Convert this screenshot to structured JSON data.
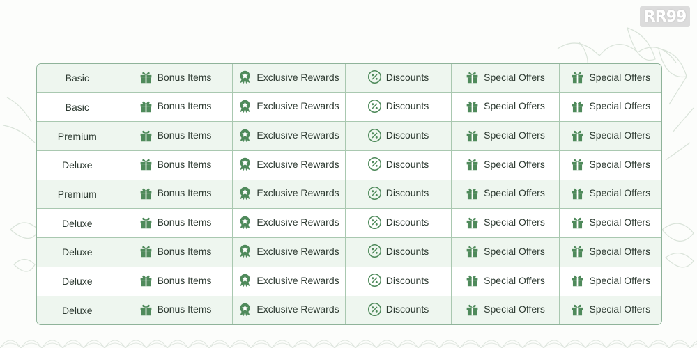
{
  "brand": {
    "logo_text": "RR99"
  },
  "colors": {
    "icon_green": "#4f8a5b",
    "row_tint": "#eef6ef",
    "border": "#a9c8b0"
  },
  "table": {
    "rows": [
      {
        "tier": "Basic",
        "cells": [
          "Bonus Items",
          "Exclusive Rewards",
          "Discounts",
          "Special Offers",
          "Special Offers"
        ]
      },
      {
        "tier": "Basic",
        "cells": [
          "Bonus Items",
          "Exclusive Rewards",
          "Discounts",
          "Special Offers",
          "Special Offers"
        ]
      },
      {
        "tier": "Premium",
        "cells": [
          "Bonus Items",
          "Exclusive Rewards",
          "Discounts",
          "Special Offers",
          "Special Offers"
        ]
      },
      {
        "tier": "Deluxe",
        "cells": [
          "Bonus Items",
          "Exclusive Rewards",
          "Discounts",
          "Special Offers",
          "Special Offers"
        ]
      },
      {
        "tier": "Premium",
        "cells": [
          "Bonus Items",
          "Exclusive Rewards",
          "Discounts",
          "Special Offers",
          "Special Offers"
        ]
      },
      {
        "tier": "Deluxe",
        "cells": [
          "Bonus Items",
          "Exclusive Rewards",
          "Discounts",
          "Special Offers",
          "Special Offers"
        ]
      },
      {
        "tier": "Deluxe",
        "cells": [
          "Bonus Items",
          "Exclusive Rewards",
          "Discounts",
          "Special Offers",
          "Special Offers"
        ]
      },
      {
        "tier": "Deluxe",
        "cells": [
          "Bonus Items",
          "Exclusive Rewards",
          "Discounts",
          "Special Offers",
          "Special Offers"
        ]
      },
      {
        "tier": "Deluxe",
        "cells": [
          "Bonus Items",
          "Exclusive Rewards",
          "Discounts",
          "Special Offers",
          "Special Offers"
        ]
      }
    ],
    "column_icons": [
      "gift-icon",
      "award-badge-icon",
      "percent-icon",
      "gift-icon",
      "gift-icon"
    ]
  }
}
